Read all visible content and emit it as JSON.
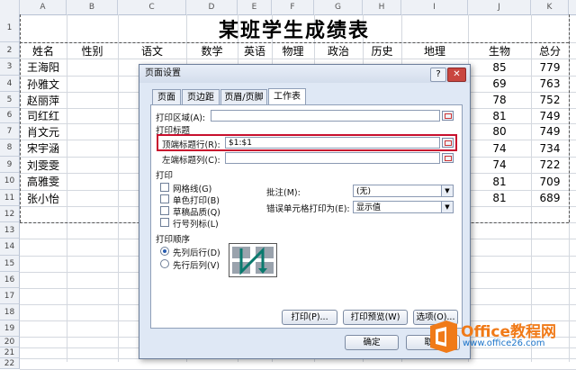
{
  "columns": [
    "A",
    "B",
    "C",
    "D",
    "E",
    "F",
    "G",
    "H",
    "I",
    "J",
    "K"
  ],
  "rows": [
    "1",
    "2",
    "3",
    "4",
    "5",
    "6",
    "7",
    "8",
    "9",
    "10",
    "11",
    "12",
    "13",
    "14",
    "15",
    "16",
    "17",
    "18",
    "19",
    "20",
    "21",
    "22"
  ],
  "sheet": {
    "title": "某班学生成绩表",
    "headers": [
      "姓名",
      "性别",
      "语文",
      "数学",
      "英语",
      "物理",
      "政治",
      "历史",
      "地理",
      "生物",
      "总分"
    ],
    "names": [
      "王海阳",
      "孙雅文",
      "赵丽萍",
      "司红红",
      "肖文元",
      "宋宇涵",
      "刘雯雯",
      "高雅雯",
      "张小怡"
    ],
    "biology": [
      "85",
      "69",
      "78",
      "81",
      "80",
      "74",
      "74",
      "81",
      "81"
    ],
    "totals": [
      "779",
      "763",
      "752",
      "749",
      "749",
      "734",
      "722",
      "709",
      "689"
    ]
  },
  "dialog": {
    "title": "页面设置",
    "help": "?",
    "close": "✕",
    "tabs": [
      "页面",
      "页边距",
      "页眉/页脚",
      "工作表"
    ],
    "print_area_label": "打印区域(A):",
    "print_titles_label": "打印标题",
    "top_rows_label": "顶端标题行(R):",
    "top_rows_value": "$1:$1",
    "left_cols_label": "左端标题列(C):",
    "print_label": "打印",
    "gridlines": "网格线(G)",
    "mono": "单色打印(B)",
    "draft": "草稿品质(Q)",
    "rowcol": "行号列标(L)",
    "comments_label": "批注(M):",
    "comments_value": "(无)",
    "errors_label": "错误单元格打印为(E):",
    "errors_value": "显示值",
    "order_label": "打印顺序",
    "down_then_over": "先列后行(D)",
    "over_then_down": "先行后列(V)",
    "print_btn": "打印(P)...",
    "preview_btn": "打印预览(W)",
    "options_btn": "选项(O)...",
    "ok_btn": "确定",
    "cancel_btn": "取消"
  },
  "watermark": {
    "brand": "Office教程网",
    "url": "www.office26.com",
    "colors": {
      "orange": "#f07a18",
      "blue": "#1a73c9"
    }
  }
}
